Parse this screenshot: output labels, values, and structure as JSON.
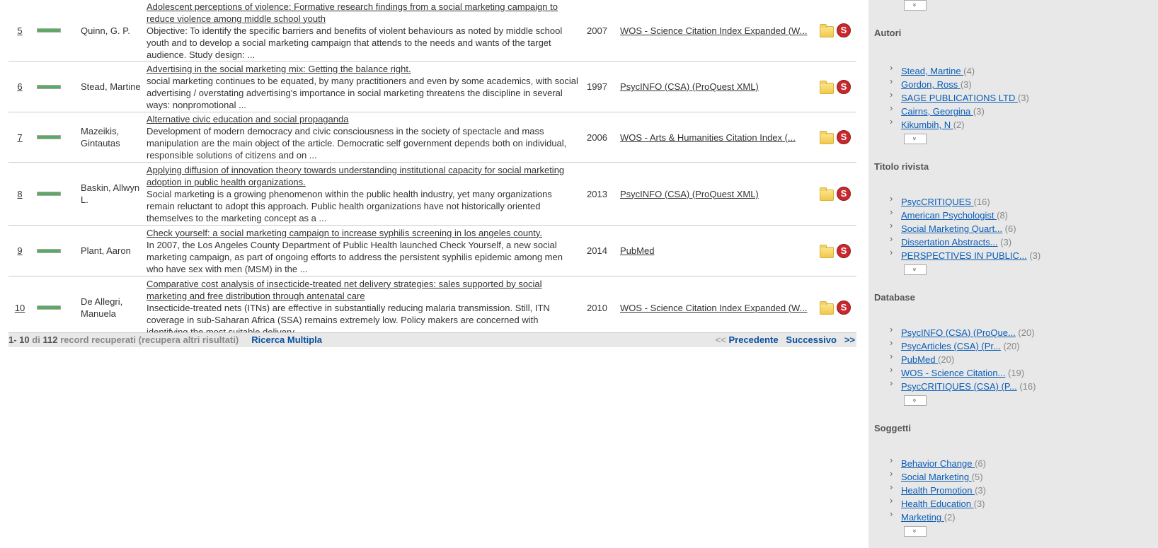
{
  "results": [
    {
      "num": "5",
      "author": "Quinn, G. P.",
      "title": "Adolescent perceptions of violence: Formative research findings from a social marketing campaign to reduce violence among middle school youth",
      "abstract": "Objective: To identify the specific barriers and benefits of violent behaviours as noted by middle school youth and to develop a social marketing campaign that attends to the needs and wants of the target audience. Study design: ...",
      "year": "2007",
      "db": "WOS - Science Citation Index Expanded (W..."
    },
    {
      "num": "6",
      "author": "Stead, Martine",
      "title": "Advertising in the social marketing mix: Getting the balance right.",
      "abstract": "social marketing continues to be equated, by many practitioners and even by some academics, with social advertising / overstating advertising's importance in social marketing threatens the discipline in several ways: nonpromotional ...",
      "year": "1997",
      "db": "PsycINFO (CSA) (ProQuest XML)"
    },
    {
      "num": "7",
      "author": "Mazeikis, Gintautas",
      "title": "Alternative civic education and social propaganda",
      "abstract": "Development of modern democracy and civic consciousness in the society of spectacle and mass manipulation are the main object of the article. Democratic self government depends both on individual, responsible solutions of citizens and on ...",
      "year": "2006",
      "db": "WOS - Arts & Humanities Citation Index (..."
    },
    {
      "num": "8",
      "author": "Baskin, Allwyn L.",
      "title": "Applying diffusion of innovation theory towards understanding institutional capacity for social marketing adoption in public health organizations.",
      "abstract": "Social marketing is a growing phenomenon within the public health industry, yet many organizations remain reluctant to adopt this approach. Public health organizations have not historically oriented themselves to the marketing concept as a ...",
      "year": "2013",
      "db": "PsycINFO (CSA) (ProQuest XML)"
    },
    {
      "num": "9",
      "author": "Plant, Aaron",
      "title": "Check yourself: a social marketing campaign to increase syphilis screening in los angeles county.",
      "abstract": "In 2007, the Los Angeles County Department of Public Health launched Check Yourself, a new social marketing campaign, as part of ongoing efforts to address the persistent syphilis epidemic among men who have sex with men (MSM) in the ...",
      "year": "2014",
      "db": "PubMed"
    },
    {
      "num": "10",
      "author": "De Allegri, Manuela",
      "title": "Comparative cost analysis of insecticide-treated net delivery strategies: sales supported by social marketing and free distribution through antenatal care",
      "abstract": "Insecticide-treated nets (ITNs) are effective in substantially reducing malaria transmission. Still, ITN coverage in sub-Saharan Africa (SSA) remains extremely low. Policy makers are concerned with identifying the most suitable delivery ...",
      "year": "2010",
      "db": "WOS - Science Citation Index Expanded (W..."
    }
  ],
  "footer": {
    "range": "1- 10",
    "di": "di",
    "total": "112",
    "recovered": "record recuperati (",
    "more": "recupera altri risultati",
    "close": ")",
    "multi": "Ricerca Multipla",
    "prev_arrows": "<<",
    "prev": "Precedente",
    "next": "Successivo",
    "next_arrows": ">>"
  },
  "sidebar": {
    "more_label": "»",
    "sections": [
      {
        "title": "Autori",
        "items": [
          {
            "label": "Stead, Martine ",
            "count": "(4)"
          },
          {
            "label": "Gordon, Ross ",
            "count": "(3)"
          },
          {
            "label": "SAGE PUBLICATIONS LTD ",
            "count": "(3)"
          },
          {
            "label": "Cairns, Georgina ",
            "count": "(3)"
          },
          {
            "label": "Kikumbih, N ",
            "count": "(2)"
          }
        ]
      },
      {
        "title": "Titolo rivista",
        "items": [
          {
            "label": "PsycCRITIQUES ",
            "count": "(16)"
          },
          {
            "label": "American Psychologist ",
            "count": "(8)"
          },
          {
            "label": "Social Marketing Quart...",
            "count": " (6)"
          },
          {
            "label": "Dissertation Abstracts...",
            "count": " (3)"
          },
          {
            "label": "PERSPECTIVES IN PUBLIC...",
            "count": " (3)"
          }
        ]
      },
      {
        "title": "Database",
        "items": [
          {
            "label": "PsycINFO (CSA) (ProQue...",
            "count": " (20)"
          },
          {
            "label": "PsycArticles (CSA) (Pr...",
            "count": " (20)"
          },
          {
            "label": "PubMed ",
            "count": "(20)"
          },
          {
            "label": "WOS - Science Citation...",
            "count": " (19)"
          },
          {
            "label": "PsycCRITIQUES (CSA) (P...",
            "count": " (16)"
          }
        ]
      },
      {
        "title": "Soggetti",
        "items": [
          {
            "label": "Behavior Change ",
            "count": "(6)"
          },
          {
            "label": "Social Marketing ",
            "count": "(5)"
          },
          {
            "label": "Health Promotion ",
            "count": "(3)"
          },
          {
            "label": "Health Education ",
            "count": "(3)"
          },
          {
            "label": "Marketing ",
            "count": "(2)"
          }
        ]
      }
    ]
  }
}
